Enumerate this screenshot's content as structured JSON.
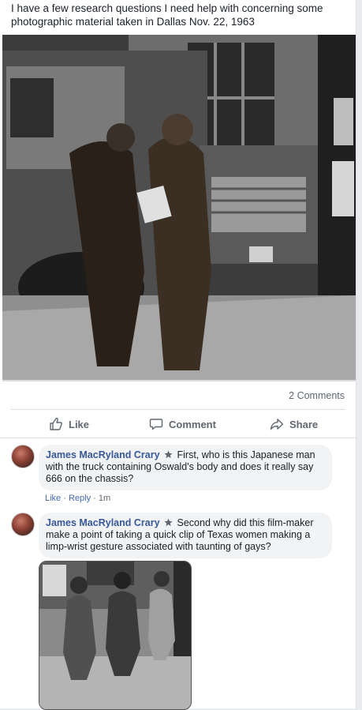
{
  "post": {
    "text": "I have a few research questions I need help with concerning some photographic material taken in Dallas Nov. 22, 1963"
  },
  "stats": {
    "comment_count": "2 Comments"
  },
  "actions": {
    "like": "Like",
    "comment": "Comment",
    "share": "Share"
  },
  "comments": [
    {
      "author": "James MacRyland Crary",
      "text": "First, who is this Japanese man with the truck containing Oswald's body and does it really say 666 on the chassis?",
      "like": "Like",
      "reply": "Reply",
      "time": "1m"
    },
    {
      "author": "James MacRyland Crary",
      "text": "Second why did this film-maker make a point of taking a quick clip of Texas women making a limp-wrist gesture associated with taunting of gays?"
    }
  ],
  "colors": {
    "link": "#385898",
    "meta_link": "#4267b2",
    "text": "#1d2129",
    "muted": "#606770"
  }
}
